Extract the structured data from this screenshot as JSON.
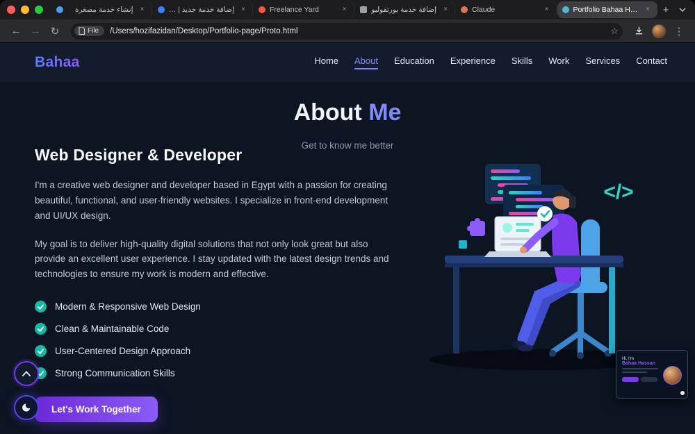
{
  "browser": {
    "tabs": [
      {
        "label": "إنشاء خدمة مصغرة",
        "favicon_color": "#4a9df0",
        "favicon_shape": "circle",
        "active": false
      },
      {
        "label": "إضافة خدمة جديد | نفذلي",
        "favicon_color": "#3b82f6",
        "favicon_shape": "circle",
        "active": false
      },
      {
        "label": "Freelance Yard",
        "favicon_color": "#f05a3c",
        "favicon_shape": "circle",
        "active": false
      },
      {
        "label": "إضافة خدمة بورتفوليو",
        "favicon_color": "#9aa0a6",
        "favicon_shape": "square",
        "active": false
      },
      {
        "label": "Claude",
        "favicon_color": "#d97757",
        "favicon_shape": "circle",
        "active": false
      },
      {
        "label": "Portfolio Bahaa Hassan",
        "favicon_color": "#4db8d8",
        "favicon_shape": "circle",
        "active": true
      }
    ],
    "new_tab_label": "+",
    "url_badge": "File",
    "url": "/Users/hozifazidan/Desktop/Portfolio-page/Proto.html"
  },
  "nav": {
    "logo": "Bahaa",
    "items": [
      {
        "label": "Home",
        "active": false
      },
      {
        "label": "About",
        "active": true
      },
      {
        "label": "Education",
        "active": false
      },
      {
        "label": "Experience",
        "active": false
      },
      {
        "label": "Skills",
        "active": false
      },
      {
        "label": "Work",
        "active": false
      },
      {
        "label": "Services",
        "active": false
      },
      {
        "label": "Contact",
        "active": false
      }
    ]
  },
  "about": {
    "title_main": "About ",
    "title_accent": "Me",
    "subtitle": "Get to know me better",
    "heading": "Web Designer & Developer",
    "paragraph1": "I'm a creative web designer and developer based in Egypt with a passion for creating beautiful, functional, and user-friendly websites. I specialize in front-end development and UI/UX design.",
    "paragraph2": "My goal is to deliver high-quality digital solutions that not only look great but also provide an excellent user experience. I stay updated with the latest design trends and technologies to ensure my work is modern and effective.",
    "checklist": [
      "Modern & Responsive Web Design",
      "Clean & Maintainable Code",
      "User-Centered Design Approach",
      "Strong Communication Skills"
    ],
    "cta_label": "Let's Work Together"
  },
  "illustration": {
    "code_symbol": "</>"
  },
  "preview": {
    "greeting_prefix": "Hi, I'm",
    "name": "Bahaa Hassan"
  },
  "colors": {
    "accent": "#818cf8",
    "primary_purple": "#7c3aed",
    "teal": "#14b8a6",
    "page_bg": "#0d1523",
    "navbar_bg": "#121c2c",
    "button_gradient_start": "#6d28d9",
    "button_gradient_end": "#8b5cf6"
  }
}
